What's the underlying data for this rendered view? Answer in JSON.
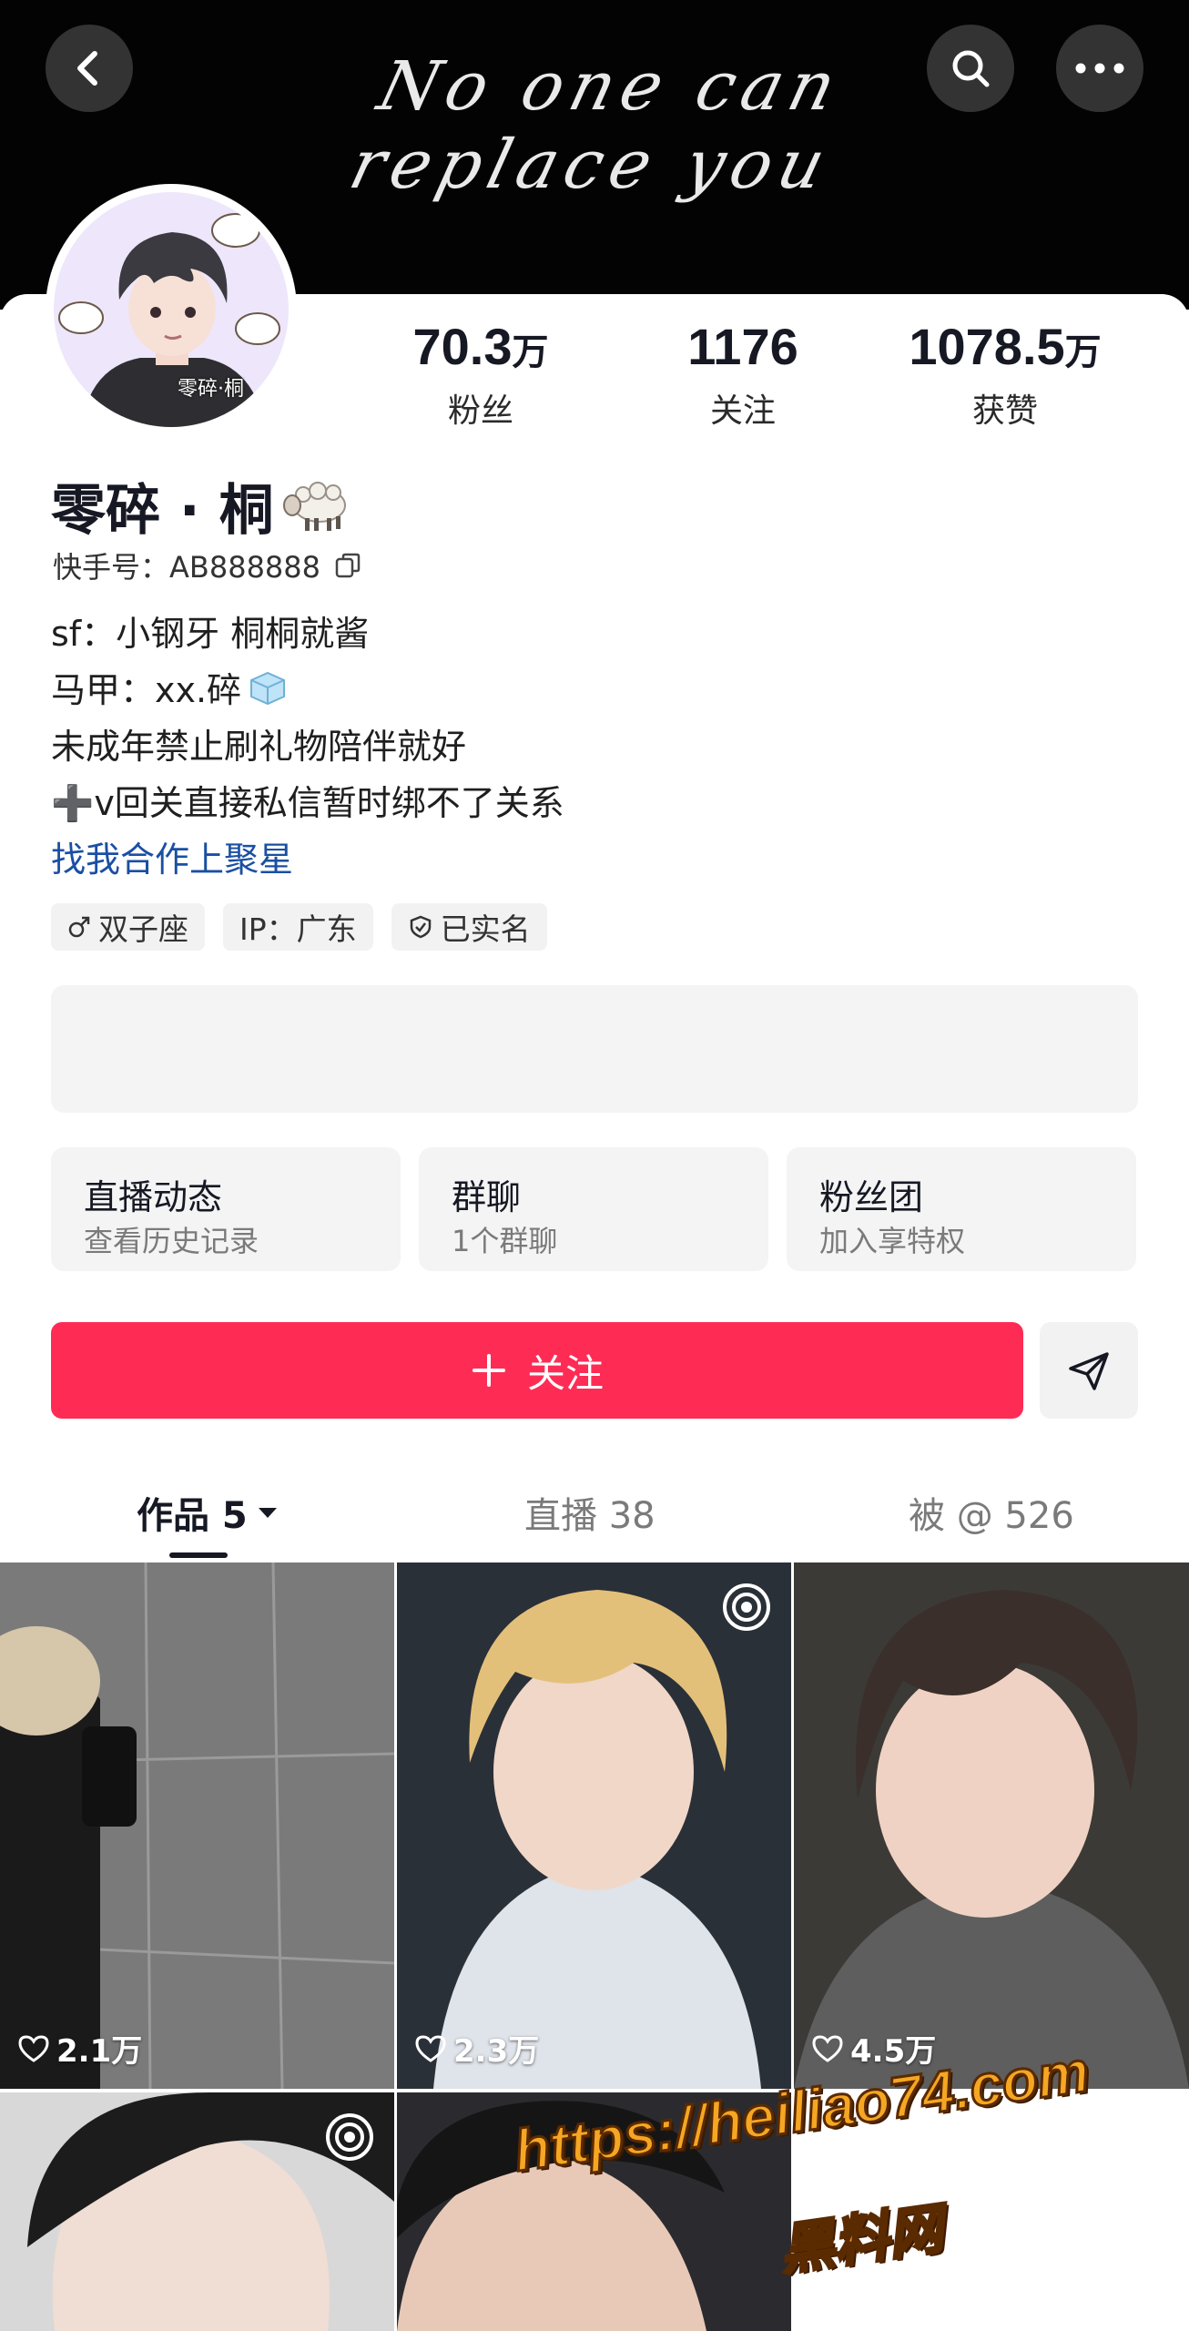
{
  "cover": {
    "script_text": "No one can replace you"
  },
  "avatar": {
    "caption": "零碎·桐"
  },
  "stats": [
    {
      "num": "70.3",
      "unit": "万",
      "label": "粉丝"
    },
    {
      "num": "1176",
      "unit": "",
      "label": "关注"
    },
    {
      "num": "1078.5",
      "unit": "万",
      "label": "获赞"
    }
  ],
  "profile": {
    "name": "零碎 · 桐",
    "kuaishou_id": "快手号：AB888888",
    "bio": [
      "sf：小钢牙 桐桐就酱",
      "马甲：xx.碎",
      "未成年禁止刷礼物陪伴就好",
      "➕v回关直接私信暂时绑不了关系"
    ],
    "bio_link": "找我合作上聚星",
    "tags": [
      "双子座",
      "IP：广东",
      "已实名"
    ]
  },
  "cards": [
    {
      "title": "直播动态",
      "sub": "查看历史记录"
    },
    {
      "title": "群聊",
      "sub": "1个群聊"
    },
    {
      "title": "粉丝团",
      "sub": "加入享特权"
    }
  ],
  "follow_label": "关注",
  "tabs": {
    "works": "作品 5",
    "live": "直播 38",
    "mentions": "被 @ 526"
  },
  "posts": [
    {
      "likes": "2.1万"
    },
    {
      "likes": "2.3万"
    },
    {
      "likes": "4.5万"
    },
    {
      "likes": ""
    },
    {
      "likes": ""
    }
  ],
  "watermark": {
    "url": "https://heiliao74.com",
    "site": "黑料网"
  },
  "colors": {
    "accent": "#fe2c55",
    "link": "#1a4fa3",
    "cover": "#030303"
  },
  "icons": [
    "back-icon",
    "search-icon",
    "more-icon",
    "copy-icon",
    "male-icon",
    "verified-icon",
    "send-icon",
    "heart-icon",
    "live-icon",
    "dropdown-icon"
  ]
}
